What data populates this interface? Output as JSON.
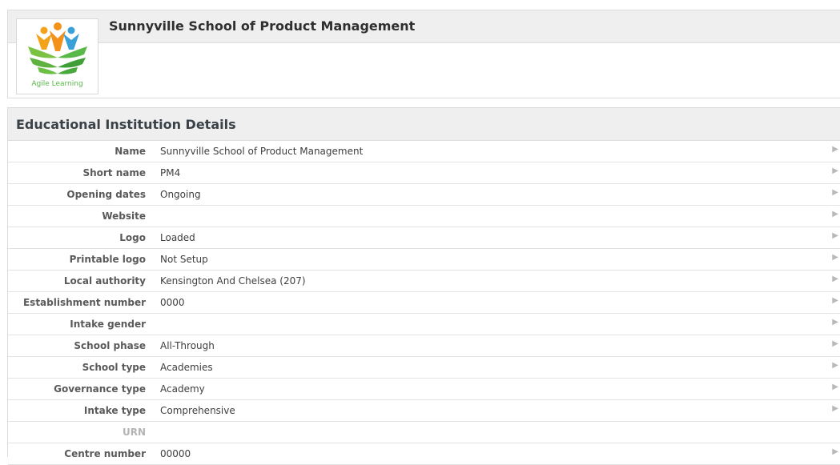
{
  "school": {
    "title": "Sunnyville School of Product Management",
    "logo_caption": "Agile Learning"
  },
  "details": {
    "title": "Educational Institution Details",
    "rows": [
      {
        "label": "Name",
        "value": "Sunnyville School of Product Management",
        "editable": true
      },
      {
        "label": "Short name",
        "value": "PM4",
        "editable": true
      },
      {
        "label": "Opening dates",
        "value": "Ongoing",
        "editable": true
      },
      {
        "label": "Website",
        "value": "",
        "editable": true
      },
      {
        "label": "Logo",
        "value": "Loaded",
        "editable": true
      },
      {
        "label": "Printable logo",
        "value": "Not Setup",
        "editable": true
      },
      {
        "label": "Local authority",
        "value": "Kensington And Chelsea (207)",
        "editable": true
      },
      {
        "label": "Establishment number",
        "value": "0000",
        "editable": true
      },
      {
        "label": "Intake gender",
        "value": "",
        "editable": true
      },
      {
        "label": "School phase",
        "value": "All-Through",
        "editable": true
      },
      {
        "label": "School type",
        "value": "Academies",
        "editable": true
      },
      {
        "label": "Governance type",
        "value": "Academy",
        "editable": true
      },
      {
        "label": "Intake type",
        "value": "Comprehensive",
        "editable": true
      },
      {
        "label": "URN",
        "value": "",
        "editable": false
      },
      {
        "label": "Centre number",
        "value": "00000",
        "editable": true
      }
    ]
  },
  "icons": {
    "row_arrow": "expand-arrow-icon",
    "logo": "agile-learning-logo"
  },
  "colors": {
    "header_bg": "#efefef",
    "logo_green": "#58b848",
    "logo_orange": "#f5a21b",
    "logo_blue": "#3aa1d8"
  }
}
